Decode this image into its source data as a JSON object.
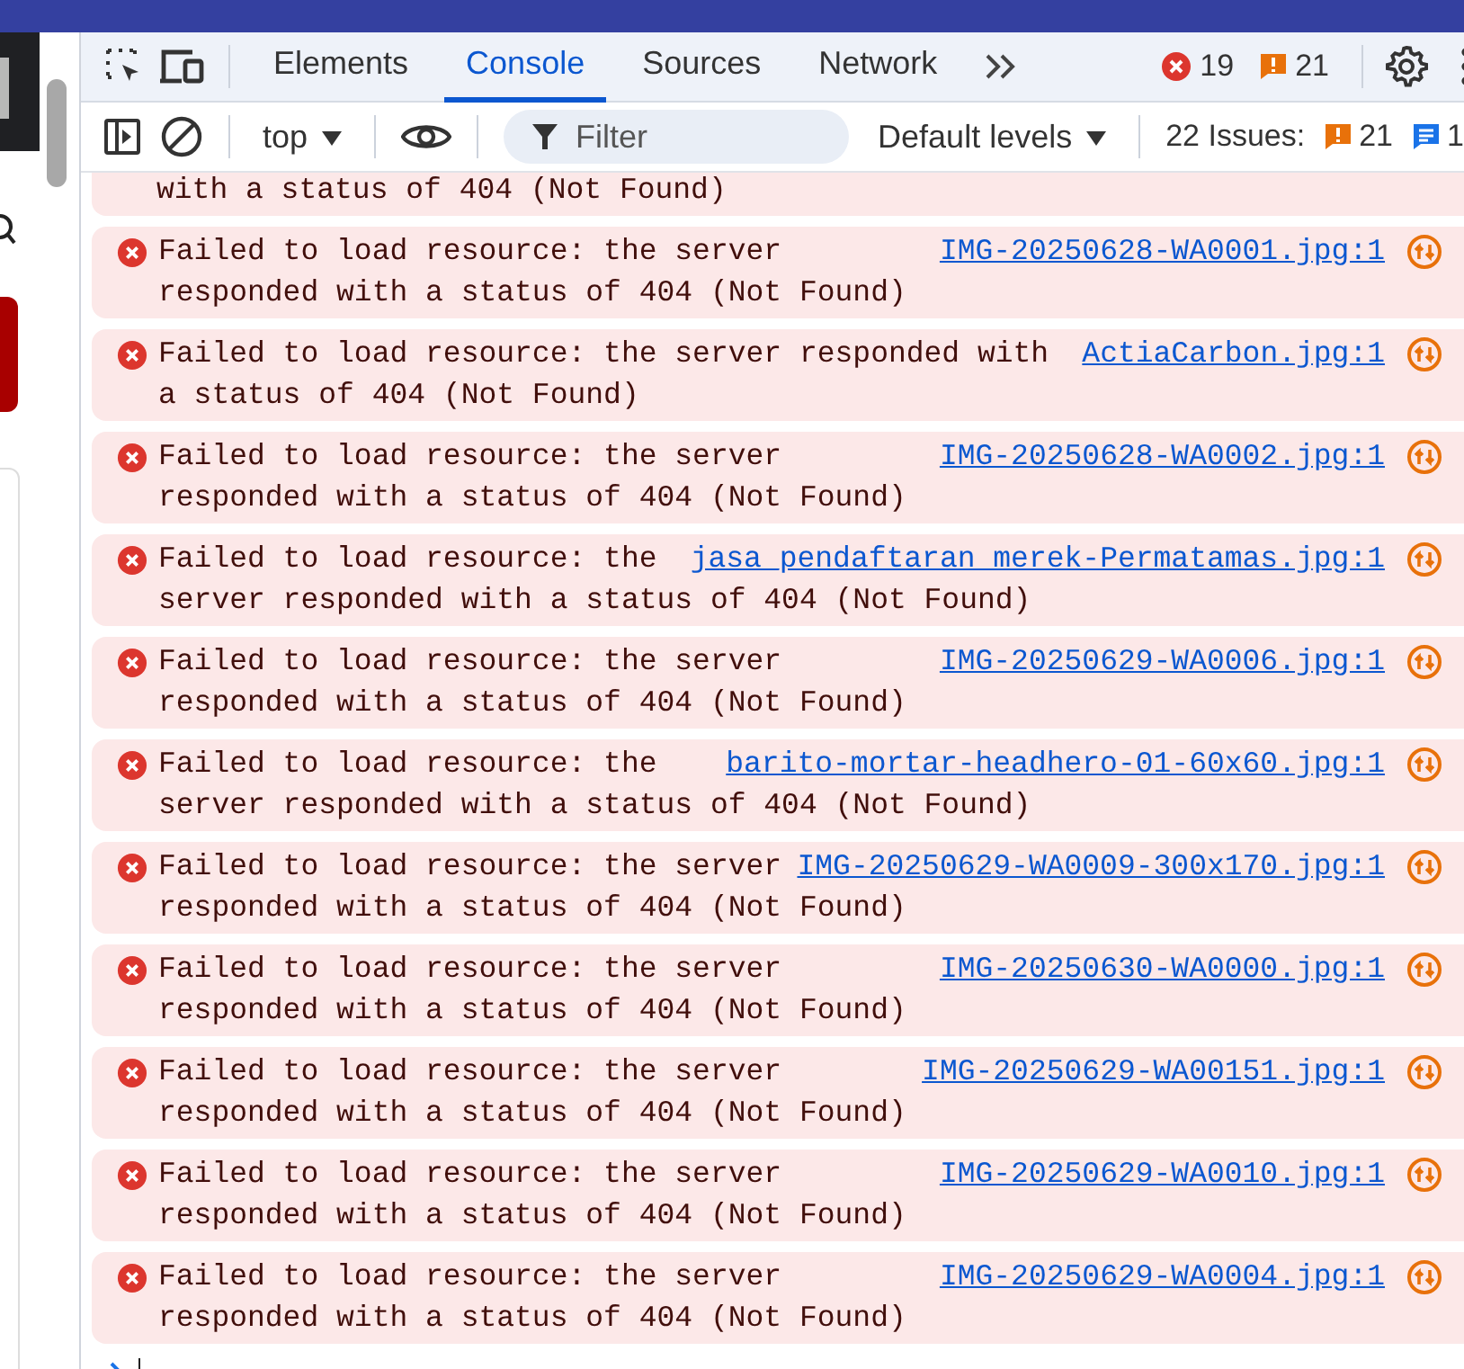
{
  "tabs": [
    {
      "label": "Elements",
      "selected": false
    },
    {
      "label": "Console",
      "selected": true
    },
    {
      "label": "Sources",
      "selected": false
    },
    {
      "label": "Network",
      "selected": false
    }
  ],
  "counters": {
    "errors": "19",
    "warnings": "21"
  },
  "console_toolbar": {
    "context": "top",
    "filter": {
      "placeholder": "Filter"
    },
    "levels": "Default levels",
    "issues_label": "22 Issues:",
    "issue_warnings": "21",
    "issue_info": "1"
  },
  "messages": [
    {
      "kind": "partial",
      "lines": [
        "with a status of 404 (Not Found)"
      ]
    },
    {
      "kind": "error",
      "lines": [
        "Failed to load resource: the server",
        "responded with a status of 404 (Not Found)"
      ],
      "source": "IMG-20250628-WA0001.jpg:1"
    },
    {
      "kind": "error",
      "lines": [
        "Failed to load resource: the server responded with",
        "a status of 404 (Not Found)"
      ],
      "source": "ActiaCarbon.jpg:1"
    },
    {
      "kind": "error",
      "lines": [
        "Failed to load resource: the server",
        "responded with a status of 404 (Not Found)"
      ],
      "source": "IMG-20250628-WA0002.jpg:1"
    },
    {
      "kind": "error",
      "lines": [
        "Failed to load resource: the",
        "server responded with a status of 404 (Not Found)"
      ],
      "source": "jasa_pendaftaran_merek-Permatamas.jpg:1"
    },
    {
      "kind": "error",
      "lines": [
        "Failed to load resource: the server",
        "responded with a status of 404 (Not Found)"
      ],
      "source": "IMG-20250629-WA0006.jpg:1"
    },
    {
      "kind": "error",
      "lines": [
        "Failed to load resource: the",
        "server responded with a status of 404 (Not Found)"
      ],
      "source": "barito-mortar-headhero-01-60x60.jpg:1"
    },
    {
      "kind": "error",
      "lines": [
        "Failed to load resource: the server",
        "responded with a status of 404 (Not Found)"
      ],
      "source": "IMG-20250629-WA0009-300x170.jpg:1"
    },
    {
      "kind": "error",
      "lines": [
        "Failed to load resource: the server",
        "responded with a status of 404 (Not Found)"
      ],
      "source": "IMG-20250630-WA0000.jpg:1"
    },
    {
      "kind": "error",
      "lines": [
        "Failed to load resource: the server",
        "responded with a status of 404 (Not Found)"
      ],
      "source": "IMG-20250629-WA00151.jpg:1"
    },
    {
      "kind": "error",
      "lines": [
        "Failed to load resource: the server",
        "responded with a status of 404 (Not Found)"
      ],
      "source": "IMG-20250629-WA0010.jpg:1"
    },
    {
      "kind": "error",
      "lines": [
        "Failed to load resource: the server",
        "responded with a status of 404 (Not Found)"
      ],
      "source": "IMG-20250629-WA0004.jpg:1"
    }
  ]
}
